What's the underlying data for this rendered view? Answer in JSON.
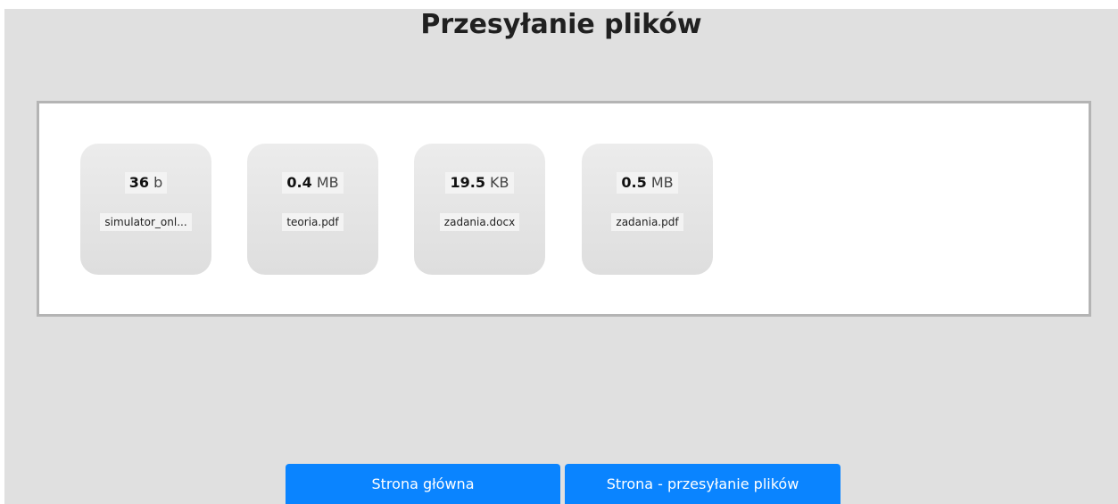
{
  "page": {
    "title": "Przesyłanie plików"
  },
  "files": [
    {
      "size_value": "36",
      "size_unit": "b",
      "name": "simulator_onl..."
    },
    {
      "size_value": "0.4",
      "size_unit": "MB",
      "name": "teoria.pdf"
    },
    {
      "size_value": "19.5",
      "size_unit": "KB",
      "name": "zadania.docx"
    },
    {
      "size_value": "0.5",
      "size_unit": "MB",
      "name": "zadania.pdf"
    }
  ],
  "nav": {
    "home_label": "Strona główna",
    "upload_label": "Strona - przesyłanie plików"
  },
  "colors": {
    "background": "#e0e0e0",
    "button": "#0a84ff",
    "dropzone_border": "#b4b4b4"
  }
}
